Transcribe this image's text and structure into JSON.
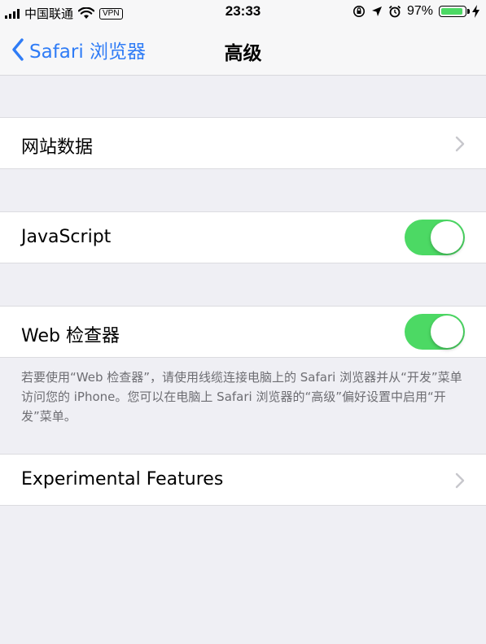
{
  "status_bar": {
    "carrier": "中国联通",
    "vpn": "VPN",
    "time": "23:33",
    "battery": "97%"
  },
  "nav": {
    "back_label": "Safari 浏览器",
    "title": "高级"
  },
  "rows": {
    "website_data": "网站数据",
    "javascript": "JavaScript",
    "web_inspector": "Web 检查器",
    "experimental": "Experimental Features"
  },
  "note": "若要使用“Web 检查器”，请使用线缆连接电脑上的 Safari 浏览器并从“开发”菜单访问您的 iPhone。您可以在电脑上 Safari 浏览器的“高级”偏好设置中启用“开发”菜单。",
  "colors": {
    "accent": "#2f7cf6",
    "toggle_on": "#4cd964",
    "background": "#efeff4"
  }
}
